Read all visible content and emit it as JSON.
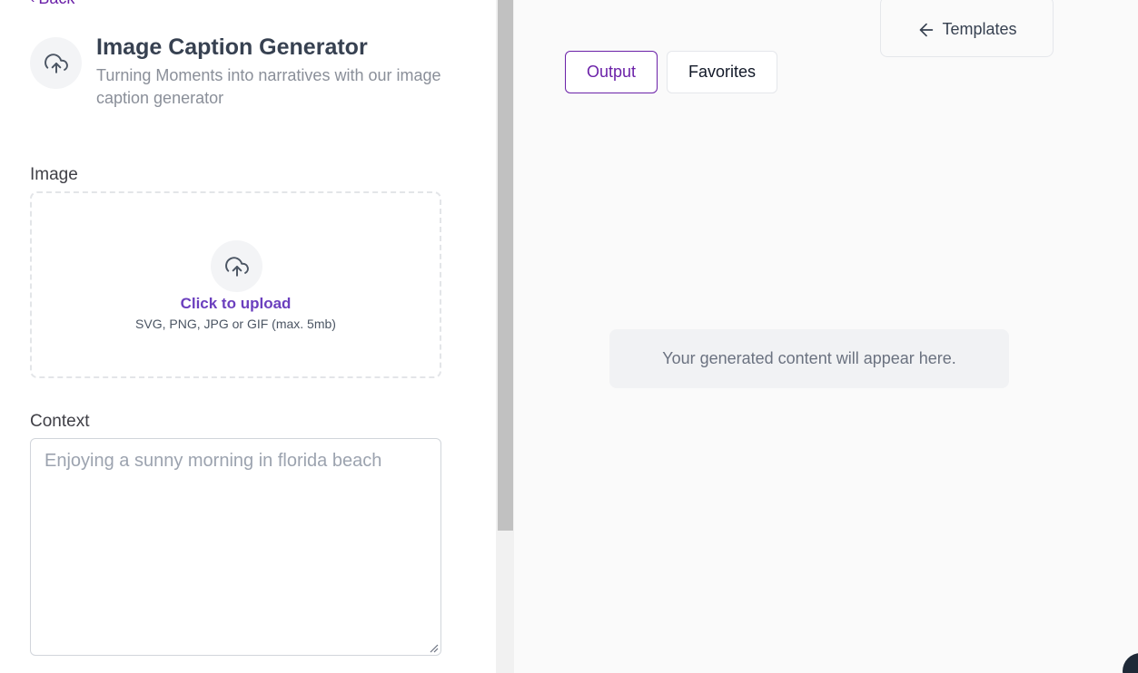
{
  "nav": {
    "back_label": "Back"
  },
  "header": {
    "title": "Image Caption Generator",
    "subtitle": "Turning Moments into narratives with our image caption generator",
    "icon": "upload-cloud-icon"
  },
  "form": {
    "image_label": "Image",
    "upload": {
      "cta": "Click to upload",
      "hint": "SVG, PNG, JPG or GIF (max. 5mb)",
      "icon": "upload-cloud-icon"
    },
    "context_label": "Context",
    "context_placeholder": "Enjoying a sunny morning in florida beach",
    "context_value": ""
  },
  "output": {
    "templates_label": "Templates",
    "tabs": [
      {
        "label": "Output",
        "active": true
      },
      {
        "label": "Favorites",
        "active": false
      }
    ],
    "empty_message": "Your generated content will appear here."
  },
  "colors": {
    "accent": "#6b21a8",
    "upload_cta": "#6b3fbe",
    "muted_text": "#8a8f99",
    "right_bg": "#fafafa"
  }
}
